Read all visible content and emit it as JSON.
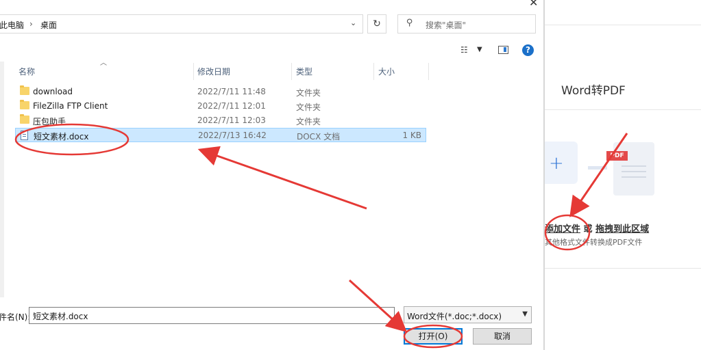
{
  "dialog": {
    "breadcrumb": [
      "此电脑",
      "桌面"
    ],
    "search_placeholder": "搜索\"桌面\"",
    "columns": {
      "name": "名称",
      "date": "修改日期",
      "type": "类型",
      "size": "大小"
    },
    "files": [
      {
        "name": "download",
        "date": "2022/7/11 11:48",
        "type": "文件夹",
        "size": "",
        "icon": "folder-icon"
      },
      {
        "name": "FileZilla FTP Client",
        "date": "2022/7/11 12:01",
        "type": "文件夹",
        "size": "",
        "icon": "folder-icon"
      },
      {
        "name": "压包助手",
        "date": "2022/7/11 12:03",
        "type": "文件夹",
        "size": "",
        "icon": "folder-icon"
      },
      {
        "name": "短文素材.docx",
        "date": "2022/7/13 16:42",
        "type": "DOCX 文档",
        "size": "1 KB",
        "icon": "docx-icon",
        "selected": true
      }
    ],
    "filename_label": "件名(N):",
    "filename_value": "短文素材.docx",
    "filetype_value": "Word文件(*.doc;*.docx)",
    "open_label": "打开(O)",
    "cancel_label": "取消"
  },
  "app": {
    "title": "Word转PDF",
    "pdf_tag": "PDF",
    "add_file_link": "添加文件",
    "or_text": "或",
    "drag_link": "拖拽到此区域",
    "hint": "其他格式文件转换成PDF文件"
  },
  "colors": {
    "selection": "#cce8ff",
    "accent": "#0078d7",
    "annotation": "#e53935"
  }
}
